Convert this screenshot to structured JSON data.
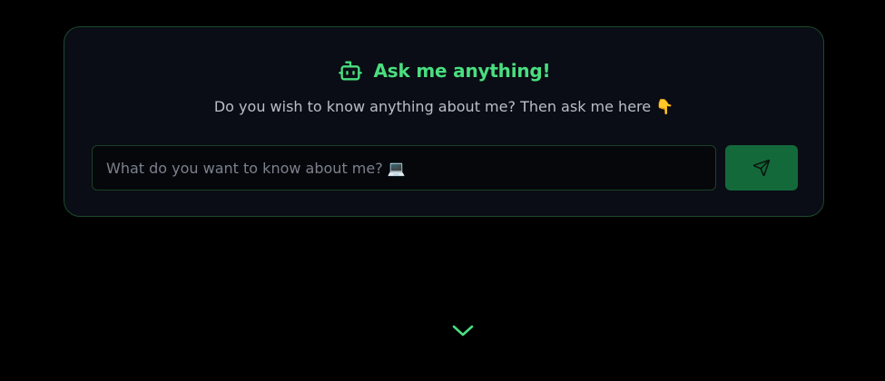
{
  "header": {
    "icon": "robot-icon",
    "title": "Ask me anything!",
    "subtitle": "Do you wish to know anything about me? Then ask me here 👇"
  },
  "query": {
    "placeholder": "What do you want to know about me? 💻",
    "value": ""
  },
  "send_button": {
    "icon": "send-icon"
  },
  "scroll": {
    "icon": "chevron-down-icon"
  },
  "colors": {
    "background": "#000000",
    "card": "#0a0d15",
    "accent": "#4ade80",
    "button": "#14693a",
    "border": "#1c4a2a"
  }
}
